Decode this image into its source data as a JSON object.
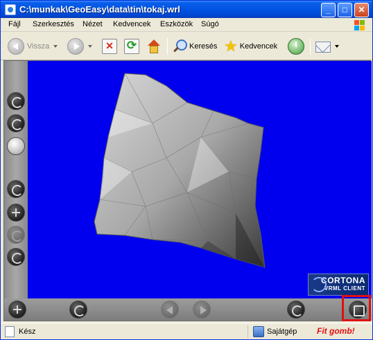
{
  "window": {
    "title": "C:\\munkak\\GeoEasy\\data\\tin\\tokaj.wrl",
    "minimize": "_",
    "maximize": "□",
    "close": "✕"
  },
  "menu": {
    "items": [
      "Fájl",
      "Szerkesztés",
      "Nézet",
      "Kedvencek",
      "Eszközök",
      "Súgó"
    ]
  },
  "toolbar": {
    "back_label": "Vissza",
    "search_label": "Keresés",
    "favorites_label": "Kedvencek"
  },
  "viewer": {
    "background_color": "#0000ee",
    "logo_line1": "CORTONA",
    "logo_line2": "VRML CLIENT"
  },
  "statusbar": {
    "status": "Kész",
    "zone": "Sajátgép",
    "annotation": "Fit gomb!"
  }
}
